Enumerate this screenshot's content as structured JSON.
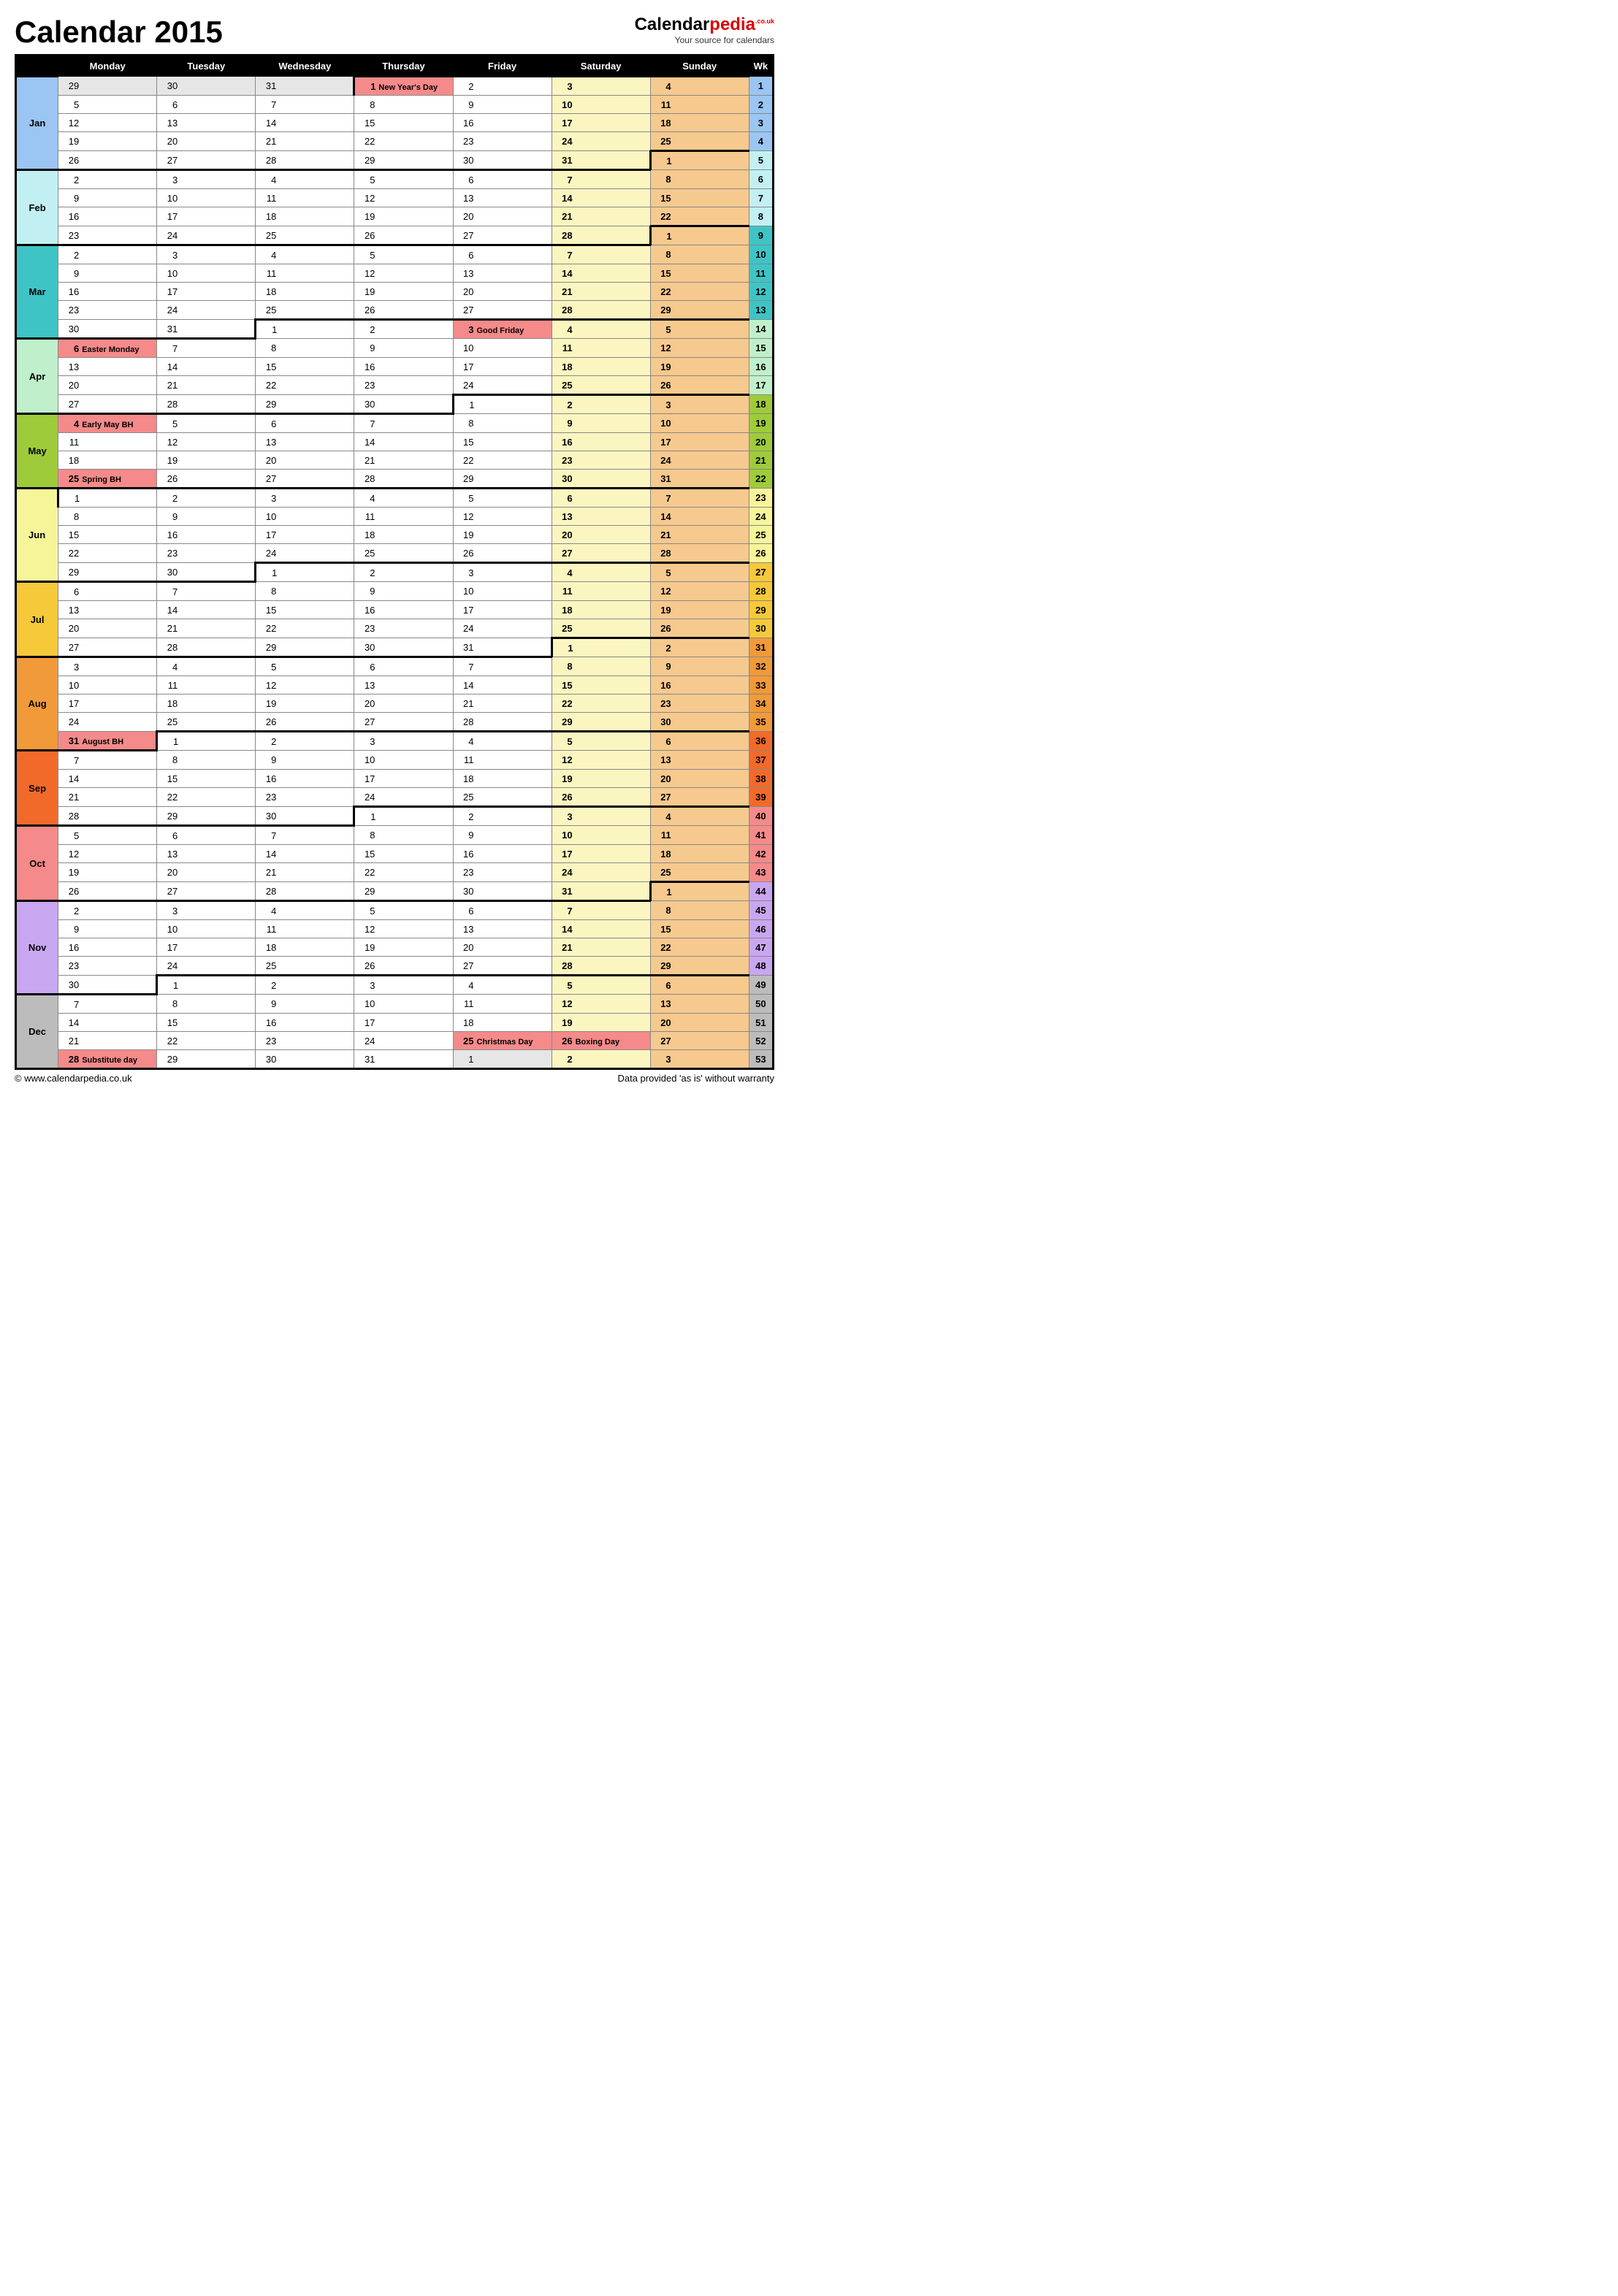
{
  "title": "Calendar 2015",
  "brand": {
    "name1": "Calendar",
    "name2": "pedia",
    "sup": ".co.uk",
    "sub": "Your source for calendars"
  },
  "footer": {
    "left": "© www.calendarpedia.co.uk",
    "right": "Data provided 'as is' without warranty"
  },
  "headers": [
    "Monday",
    "Tuesday",
    "Wednesday",
    "Thursday",
    "Friday",
    "Saturday",
    "Sunday",
    "Wk"
  ],
  "month_colors": {
    "Jan": "#9bc5f2",
    "Feb": "#c2f0f2",
    "Mar": "#3fc4c6",
    "Apr": "#c0f0cb",
    "May": "#9ecb3a",
    "Jun": "#f7f59a",
    "Jul": "#f6c93a",
    "Aug": "#f09a3a",
    "Sep": "#f26a2a",
    "Oct": "#f58a8a",
    "Nov": "#c9a6f0",
    "Dec": "#bcbcbc"
  },
  "wk_colors": {
    "Jan": "#9bc5f2",
    "Feb": "#c2f0f2",
    "Mar": "#3fc4c6",
    "Apr": "#c0f0cb",
    "May": "#9ecb3a",
    "Jun": "#f7f59a",
    "Jul": "#f6c93a",
    "Aug": "#f09a3a",
    "Sep": "#f26a2a",
    "Oct": "#f58a8a",
    "Nov": "#c9a6f0",
    "Dec": "#bcbcbc"
  },
  "months": [
    {
      "name": "Jan",
      "days": 31,
      "start": 3
    },
    {
      "name": "Feb",
      "days": 28,
      "start": 6
    },
    {
      "name": "Mar",
      "days": 31,
      "start": 6
    },
    {
      "name": "Apr",
      "days": 30,
      "start": 2
    },
    {
      "name": "May",
      "days": 31,
      "start": 4
    },
    {
      "name": "Jun",
      "days": 30,
      "start": 0
    },
    {
      "name": "Jul",
      "days": 31,
      "start": 2
    },
    {
      "name": "Aug",
      "days": 31,
      "start": 5
    },
    {
      "name": "Sep",
      "days": 30,
      "start": 1
    },
    {
      "name": "Oct",
      "days": 31,
      "start": 3
    },
    {
      "name": "Nov",
      "days": 30,
      "start": 6
    },
    {
      "name": "Dec",
      "days": 31,
      "start": 1
    }
  ],
  "prev_dec_days": 31,
  "next_jan": true,
  "holidays": {
    "Jan-1": "New Year's Day",
    "Apr-3": "Good Friday",
    "Apr-6": "Easter Monday",
    "May-4": "Early May BH",
    "May-25": "Spring BH",
    "Aug-31": "August BH",
    "Dec-25": "Christmas Day",
    "Dec-26": "Boxing Day",
    "Dec-28": "Substitute day"
  },
  "first_week_no": 1
}
